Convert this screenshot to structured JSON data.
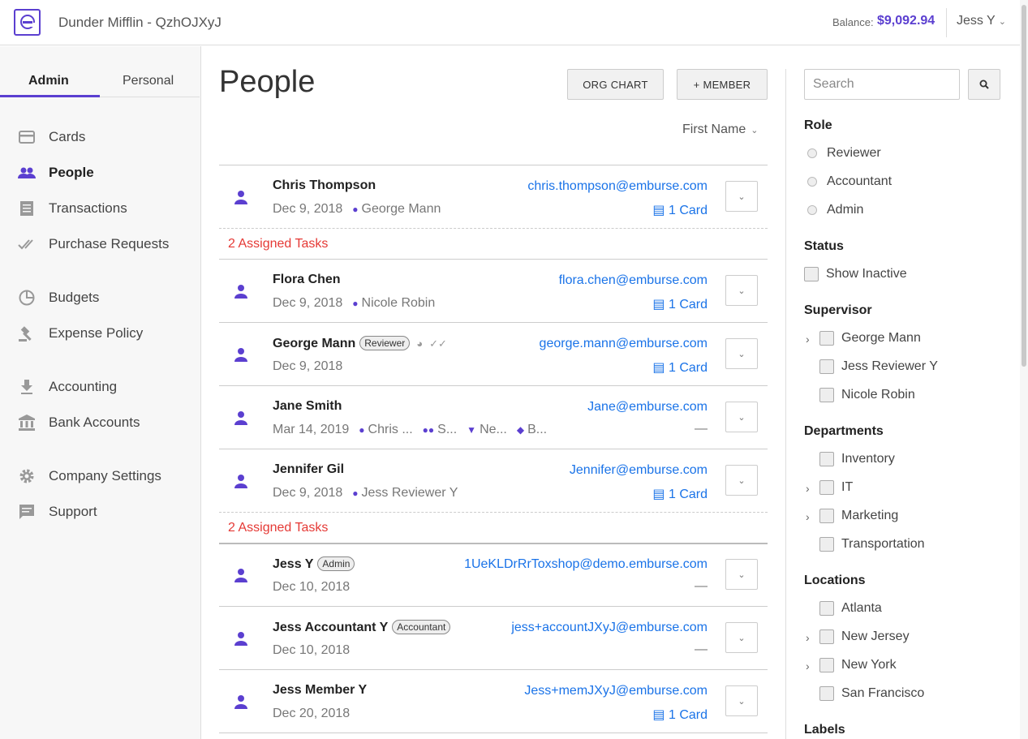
{
  "topbar": {
    "logo_letter": "e",
    "company": "Dunder Mifflin - QzhOJXyJ",
    "balance_label": "Balance:",
    "balance_value": "$9,092.94",
    "user": "Jess Y",
    "accent_color": "#5b3fd0"
  },
  "sidebar": {
    "tabs": [
      {
        "label": "Admin",
        "active": true
      },
      {
        "label": "Personal",
        "active": false
      }
    ],
    "items": [
      {
        "label": "Cards",
        "icon": "card-icon"
      },
      {
        "label": "People",
        "icon": "people-icon",
        "active": true
      },
      {
        "label": "Transactions",
        "icon": "receipt-icon"
      },
      {
        "label": "Purchase Requests",
        "icon": "double-check-icon"
      },
      {
        "label": "Budgets",
        "icon": "pie-chart-icon"
      },
      {
        "label": "Expense Policy",
        "icon": "gavel-icon"
      },
      {
        "label": "Accounting",
        "icon": "download-icon"
      },
      {
        "label": "Bank Accounts",
        "icon": "bank-icon"
      },
      {
        "label": "Company Settings",
        "icon": "gear-icon"
      },
      {
        "label": "Support",
        "icon": "chat-icon"
      }
    ]
  },
  "main": {
    "title": "People",
    "org_chart_button": "ORG CHART",
    "add_member_button": "+ MEMBER",
    "sort_label": "First Name",
    "tasks_label": "2 Assigned Tasks",
    "people": [
      {
        "name": "Chris Thompson",
        "date": "Dec 9, 2018",
        "supervisor": "George Mann",
        "email": "chris.thompson@emburse.com",
        "cards": "1 Card"
      },
      {
        "name": "Flora Chen",
        "date": "Dec 9, 2018",
        "supervisor": "Nicole Robin",
        "email": "flora.chen@emburse.com",
        "cards": "1 Card"
      },
      {
        "name": "George Mann",
        "badge": "Reviewer",
        "date": "Dec 9, 2018",
        "email": "george.mann@emburse.com",
        "cards": "1 Card"
      },
      {
        "name": "Jane Smith",
        "date": "Mar 14, 2019",
        "supervisor": "Chris ...",
        "department": "S...",
        "location": "Ne...",
        "label": "B...",
        "email": "Jane@emburse.com",
        "cards": "—"
      },
      {
        "name": "Jennifer Gil",
        "date": "Dec 9, 2018",
        "supervisor": "Jess Reviewer Y",
        "email": "Jennifer@emburse.com",
        "cards": "1 Card"
      },
      {
        "name": "Jess Y",
        "badge": "Admin",
        "date": "Dec 10, 2018",
        "email": "1UeKLDrRrToxshop@demo.emburse.com",
        "cards": "—"
      },
      {
        "name": "Jess Accountant Y",
        "badge": "Accountant",
        "date": "Dec 10, 2018",
        "email": "jess+accountJXyJ@emburse.com",
        "cards": "—"
      },
      {
        "name": "Jess Member Y",
        "date": "Dec 20, 2018",
        "email": "Jess+memJXyJ@emburse.com",
        "cards": "1 Card"
      }
    ]
  },
  "filters": {
    "search_placeholder": "Search",
    "role": {
      "heading": "Role",
      "options": [
        "Reviewer",
        "Accountant",
        "Admin"
      ]
    },
    "status": {
      "heading": "Status",
      "options": [
        "Show Inactive"
      ]
    },
    "supervisor": {
      "heading": "Supervisor",
      "options": [
        "George Mann",
        "Jess Reviewer Y",
        "Nicole Robin"
      ]
    },
    "departments": {
      "heading": "Departments",
      "options": [
        "Inventory",
        "IT",
        "Marketing",
        "Transportation"
      ]
    },
    "locations": {
      "heading": "Locations",
      "options": [
        "Atlanta",
        "New Jersey",
        "New York",
        "San Francisco"
      ]
    },
    "labels": {
      "heading": "Labels"
    }
  }
}
